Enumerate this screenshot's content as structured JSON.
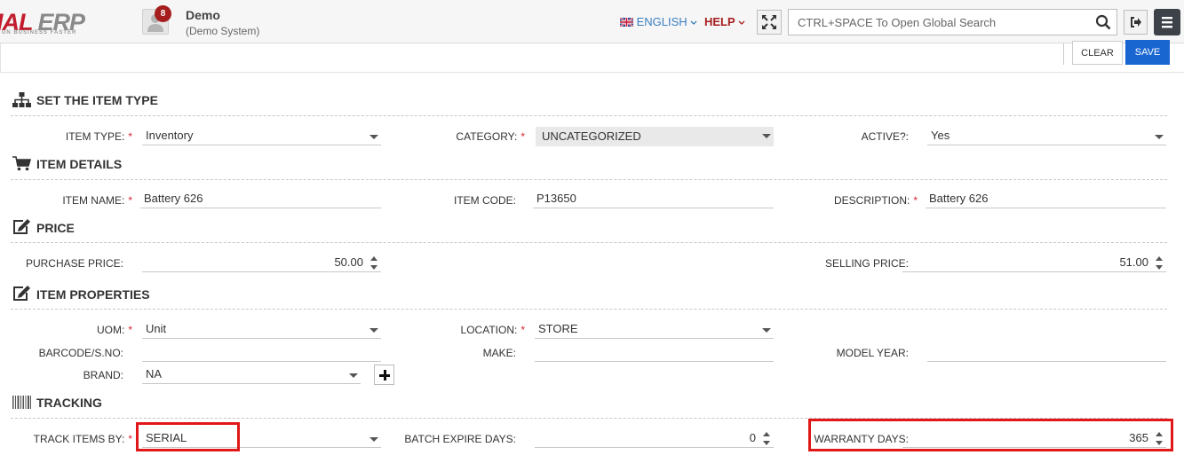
{
  "brand": {
    "logo_main": "IAL",
    "logo_erp": " ERP",
    "logo_tagline": "UN BUSINESS FASTER"
  },
  "header": {
    "notification_count": "8",
    "user_name": "Demo",
    "user_system": "(Demo System)",
    "language": "ENGLISH",
    "help": "HELP",
    "search_placeholder": "CTRL+SPACE To Open Global Search"
  },
  "actions": {
    "clear": "CLEAR",
    "save": "SAVE"
  },
  "sections": {
    "item_type": {
      "title": "SET THE ITEM TYPE",
      "item_type_label": "ITEM TYPE:",
      "item_type_value": "Inventory",
      "category_label": "CATEGORY:",
      "category_value": "UNCATEGORIZED",
      "active_label": "ACTIVE?:",
      "active_value": "Yes"
    },
    "item_details": {
      "title": "ITEM DETAILS",
      "item_name_label": "ITEM NAME:",
      "item_name_value": "Battery 626",
      "item_code_label": "ITEM CODE:",
      "item_code_value": "P13650",
      "description_label": "DESCRIPTION:",
      "description_value": "Battery 626"
    },
    "price": {
      "title": "PRICE",
      "purchase_label": "PURCHASE PRICE:",
      "purchase_value": "50.00",
      "selling_label": "SELLING PRICE:",
      "selling_value": "51.00"
    },
    "item_properties": {
      "title": "ITEM PROPERTIES",
      "uom_label": "UOM:",
      "uom_value": "Unit",
      "location_label": "LOCATION:",
      "location_value": "STORE",
      "barcode_label": "BARCODE/S.NO:",
      "barcode_value": "",
      "make_label": "MAKE:",
      "make_value": "",
      "model_year_label": "MODEL YEAR:",
      "model_year_value": "",
      "brand_label": "BRAND:",
      "brand_value": "NA"
    },
    "tracking": {
      "title": "TRACKING",
      "track_by_label": "TRACK ITEMS BY:",
      "track_by_value": "SERIAL",
      "batch_expire_label": "BATCH EXPIRE DAYS:",
      "batch_expire_value": "0",
      "warranty_label": "WARRANTY DAYS:",
      "warranty_value": "365"
    }
  },
  "required_marker": "*",
  "colors": {
    "accent_blue": "#1a66d1",
    "brand_red": "#c21d2e",
    "highlight": "#e11818"
  },
  "icons": [
    "sitemap-icon",
    "cart-icon",
    "edit-icon",
    "barcode-icon",
    "user-icon",
    "expand-icon",
    "search-icon",
    "logout-icon",
    "menu-icon",
    "uk-flag-icon",
    "chevron-down-icon",
    "plus-icon"
  ]
}
